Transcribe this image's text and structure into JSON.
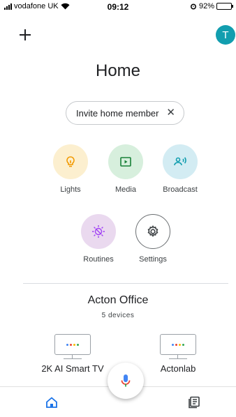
{
  "status_bar": {
    "carrier": "vodafone UK",
    "time": "09:12",
    "battery": "92%",
    "battery_level": 0.92
  },
  "header": {
    "avatar_letter": "T",
    "title": "Home"
  },
  "invite_chip": {
    "label": "Invite home member",
    "close_glyph": "✕"
  },
  "actions": [
    {
      "label": "Lights",
      "icon": "lightbulb-icon",
      "color": "#f29900"
    },
    {
      "label": "Media",
      "icon": "media-icon",
      "color": "#188038"
    },
    {
      "label": "Broadcast",
      "icon": "broadcast-icon",
      "color": "#129eaf"
    },
    {
      "label": "Routines",
      "icon": "routines-icon",
      "color": "#a142f4"
    },
    {
      "label": "Settings",
      "icon": "gear-icon",
      "color": "#3c4043"
    }
  ],
  "room": {
    "name": "Acton Office",
    "count": "5 devices",
    "devices": [
      {
        "label": "2K AI Smart TV",
        "icon": "tv-icon"
      },
      {
        "label": "Actonlab",
        "icon": "tv-icon"
      }
    ]
  },
  "colors": {
    "google_blue": "#4285f4",
    "google_red": "#ea4335",
    "google_yellow": "#fbbc04",
    "google_green": "#34a853",
    "nav_active": "#1a73e8"
  },
  "bottom_nav": [
    {
      "icon": "home-icon",
      "active": true
    },
    {
      "icon": "feed-icon",
      "active": false
    }
  ]
}
